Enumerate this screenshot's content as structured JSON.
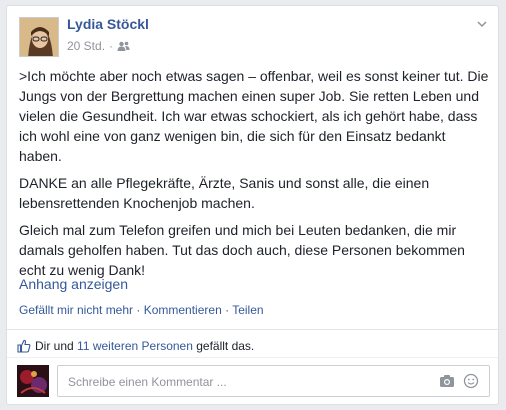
{
  "post": {
    "author": "Lydia Stöckl",
    "time": "20 Std.",
    "paragraphs": [
      ">Ich möchte aber noch etwas sagen – offenbar, weil es sonst keiner tut. Die Jungs von der Bergrettung machen einen super Job. Sie retten Leben und vielen die Gesundheit. Ich war etwas schockiert, als ich gehört habe, dass ich wohl eine von ganz wenigen bin, die sich für den Einsatz bedankt haben.",
      "DANKE an alle Pflegekräfte, Ärzte, Sanis und sonst alle, die einen lebensrettenden Knochenjob machen.",
      "Gleich mal zum Telefon greifen und mich bei Leuten bedanken, die mir damals geholfen haben. Tut das doch auch, diese Personen bekommen echt zu wenig Dank!"
    ],
    "see_more": "Anhang anzeigen"
  },
  "actions": {
    "unlike": "Gefällt mir nicht mehr",
    "separator": " · ",
    "comment": "Kommentieren",
    "share": "Teilen"
  },
  "likes": {
    "prefix": "Dir und ",
    "others": "11 weiteren Personen",
    "suffix": " gefällt das."
  },
  "comment_box": {
    "placeholder": "Schreibe einen Kommentar ..."
  },
  "icons": {
    "audience": "friends-icon",
    "menu": "chevron-down-icon",
    "like": "thumbs-up-icon",
    "camera": "camera-icon",
    "emoji": "smiley-icon"
  },
  "colors": {
    "link": "#365899",
    "meta": "#90949c",
    "text": "#1d2129"
  }
}
